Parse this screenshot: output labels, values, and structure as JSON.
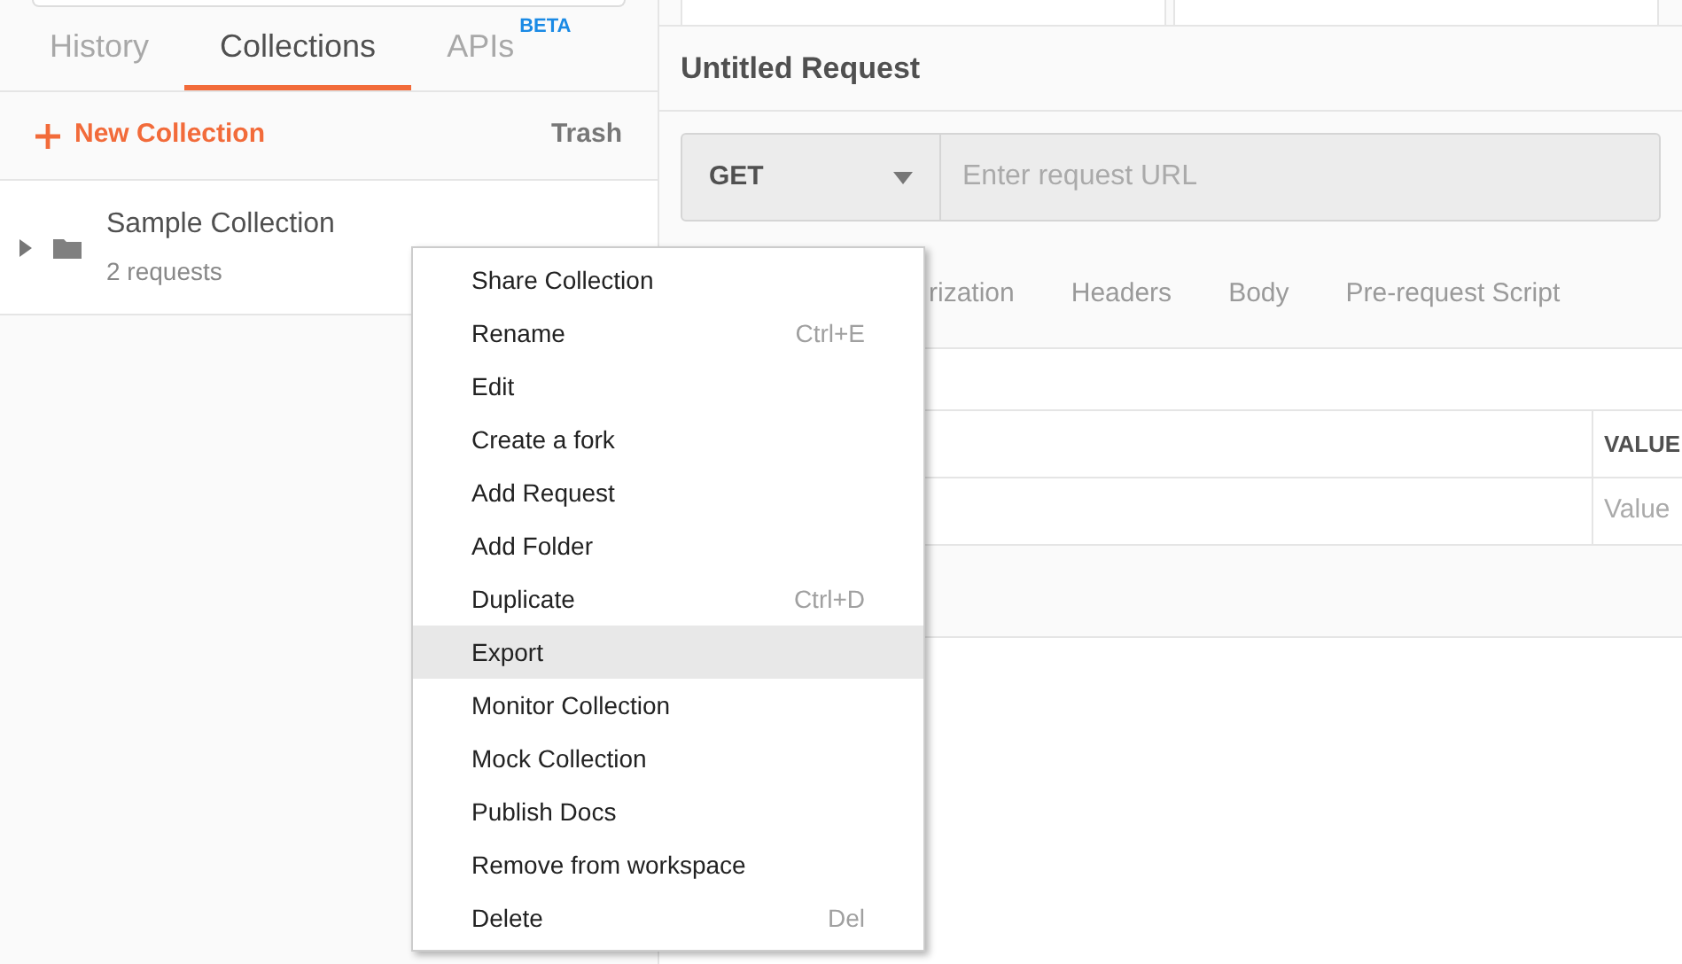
{
  "sidebar": {
    "tabs": [
      {
        "label": "History",
        "selected": false
      },
      {
        "label": "Collections",
        "selected": true
      },
      {
        "label": "APIs",
        "badge": "BETA",
        "selected": false
      }
    ],
    "new_collection": "New Collection",
    "trash": "Trash",
    "collections": [
      {
        "name": "Sample Collection",
        "count": "2 requests",
        "expanded": false
      }
    ]
  },
  "request": {
    "title": "Untitled Request",
    "method": "GET",
    "url_placeholder": "Enter request URL",
    "tabs": [
      "rization",
      "Headers",
      "Body",
      "Pre-request Script"
    ],
    "table": {
      "column_2": "VALUE",
      "value_placeholder": "Value"
    }
  },
  "context_menu": [
    {
      "label": "Share Collection",
      "selected": false
    },
    {
      "label": "Rename",
      "shortcut": "Ctrl+E",
      "selected": false
    },
    {
      "label": "Edit",
      "selected": false
    },
    {
      "label": "Create a fork",
      "selected": false
    },
    {
      "label": "Add Request",
      "selected": false
    },
    {
      "label": "Add Folder",
      "selected": false
    },
    {
      "label": "Duplicate",
      "shortcut": "Ctrl+D",
      "selected": false
    },
    {
      "label": "Export",
      "selected": true
    },
    {
      "label": "Monitor Collection",
      "selected": false
    },
    {
      "label": "Mock Collection",
      "selected": false
    },
    {
      "label": "Publish Docs",
      "selected": false
    },
    {
      "label": "Remove from workspace",
      "selected": false
    },
    {
      "label": "Delete",
      "shortcut": "Del",
      "selected": false
    }
  ]
}
